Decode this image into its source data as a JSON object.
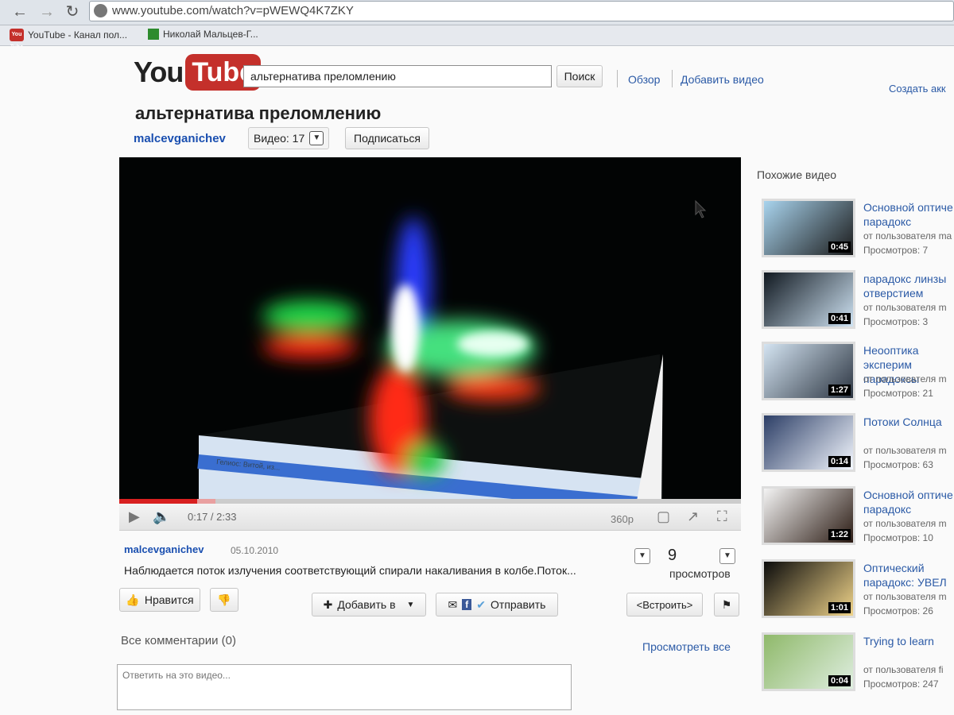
{
  "browser": {
    "url": "www.youtube.com/watch?v=pWEWQ4K7ZKY",
    "bookmarks": [
      "YouTube - Канал пол...",
      "Николай Мальцев-Г..."
    ],
    "bookmark_yt_icon_text": "You Tube"
  },
  "header": {
    "logo_you": "You",
    "logo_tube": "Tube",
    "search_value": "альтернатива преломлению",
    "search_button": "Поиск",
    "browse_link": "Обзор",
    "upload_link": "Добавить видео",
    "create_account_link": "Создать акк"
  },
  "video": {
    "title": "альтернатива преломлению",
    "channel": "malcevganichev",
    "video_count": "Видео: 17",
    "subscribe": "Подписаться",
    "taskbar_text": "Гелиос: Витой, из...",
    "progress_fraction": 0.125,
    "time": "0:17 / 2:33",
    "quality": "360p",
    "uploader": "malcevganichev",
    "date": "05.10.2010",
    "description": "Наблюдается поток излучения соответствующий спирали накаливания в колбе.Поток...",
    "views_count": "9",
    "views_label": "просмотров"
  },
  "actions": {
    "like": "Нравится",
    "add_to": "Добавить в",
    "share": "Отправить",
    "embed": "<Встроить>"
  },
  "comments": {
    "label": "Все комментарии (0)",
    "view_all": "Просмотреть все",
    "placeholder": "Ответить на это видео..."
  },
  "sidebar": {
    "heading": "Похожие видео",
    "items": [
      {
        "title": "Основной оптиче парадокс",
        "by": "от пользователя ma",
        "views": "Просмотров: 7",
        "duration": "0:45"
      },
      {
        "title": "парадокс линзы отверстием",
        "by": "от пользователя m",
        "views": "Просмотров: 3",
        "duration": "0:41"
      },
      {
        "title": "Неооптика эксперим парадоксы",
        "by": "от пользователя m",
        "views": "Просмотров: 21",
        "duration": "1:27"
      },
      {
        "title": "Потоки Солнца",
        "by": "от пользователя m",
        "views": "Просмотров: 63",
        "duration": "0:14"
      },
      {
        "title": "Основной оптиче парадокс",
        "by": "от пользователя m",
        "views": "Просмотров: 10",
        "duration": "1:22"
      },
      {
        "title": "Оптический парадокс: УВЕЛ",
        "by": "от пользователя m",
        "views": "Просмотров: 26",
        "duration": "1:01"
      },
      {
        "title": "Trying to learn",
        "by": "от пользователя fi",
        "views": "Просмотров: 247",
        "duration": "0:04"
      }
    ]
  }
}
